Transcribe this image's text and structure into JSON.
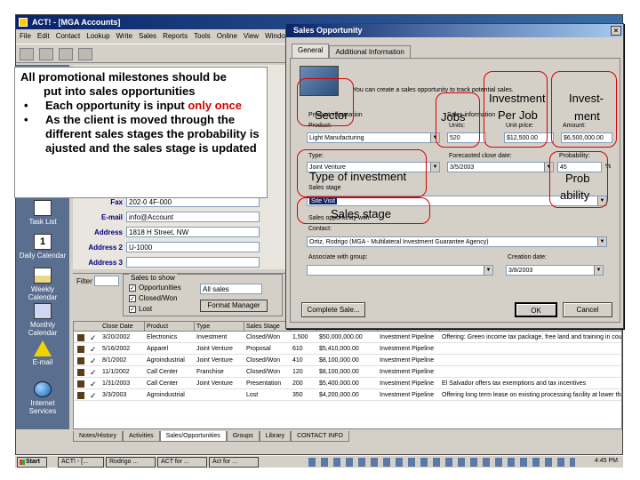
{
  "app": {
    "title": "ACT! - [MGA Accounts]",
    "menu": [
      "File",
      "Edit",
      "Contact",
      "Lookup",
      "Write",
      "Sales",
      "Reports",
      "Tools",
      "Online",
      "View",
      "Window"
    ]
  },
  "nav": {
    "items": [
      {
        "label": "Task List"
      },
      {
        "label": "Daily Calendar",
        "icon_text": "1"
      },
      {
        "label": "Weekly Calendar"
      },
      {
        "label": "Monthly Calendar"
      },
      {
        "label": "E-mail"
      },
      {
        "label": "Internet Services"
      }
    ]
  },
  "contact": {
    "fields": [
      {
        "label": "Fax",
        "value": "202-0 4F-000"
      },
      {
        "label": "E-mail",
        "value": "info@Account"
      },
      {
        "label": "Address",
        "value": "1818 H Street, NW"
      },
      {
        "label": "Address 2",
        "value": "U-1000"
      },
      {
        "label": "Address 3",
        "value": ""
      }
    ]
  },
  "filter": {
    "label": "Filter",
    "show_title": "Sales to show",
    "options": [
      {
        "label": "Opportunities",
        "checked": "✓"
      },
      {
        "label": "Closed/Won",
        "checked": "✓"
      },
      {
        "label": "Lost",
        "checked": "✓"
      }
    ],
    "select_value": "All sales",
    "format_manager": "Format Manager"
  },
  "grid": {
    "headers": [
      "Close Date",
      "Product",
      "Type",
      "Sales Stage",
      "Units",
      "Amount",
      "Manager",
      "Details"
    ],
    "rows": [
      {
        "cells": [
          "3/20/2002",
          "Electronics",
          "Investment",
          "Closed/Won",
          "1,500",
          "$50,000,000.00",
          "Investment Pipeline",
          "Offering: Green income tax package, free land and training in country"
        ]
      },
      {
        "cells": [
          "5/16/2002",
          "Apparel",
          "Joint Venture",
          "Proposal",
          "610",
          "$5,410,000.00",
          "Investment Pipeline",
          ""
        ]
      },
      {
        "cells": [
          "8/1/2002",
          "Agroindustrial",
          "Joint Venture",
          "Closed/Won",
          "410",
          "$8,100,000.00",
          "Investment Pipeline",
          ""
        ]
      },
      {
        "cells": [
          "11/1/2002",
          "Call Center",
          "Franchise",
          "Closed/Won",
          "120",
          "$8,100,000.00",
          "Investment Pipeline",
          ""
        ]
      },
      {
        "cells": [
          "1/31/2003",
          "Call Center",
          "Joint Venture",
          "Presentation",
          "200",
          "$5,400,000.00",
          "Investment Pipeline",
          "El Salvador offers tax exemptions and tax incentives"
        ]
      },
      {
        "cells": [
          "3/3/2003",
          "Agroindustrial",
          "",
          "Lost",
          "350",
          "$4,200,000.00",
          "Investment Pipeline",
          "Offering long term lease on existing processing facility at lower than market rates"
        ]
      }
    ]
  },
  "bottom_tabs": [
    "Notes/History",
    "Activities",
    "Sales/Opportunities",
    "Groups",
    "Library",
    "CONTACT INFO"
  ],
  "taskbar": {
    "start": "Start",
    "items": [
      "ACT! - [...",
      "Rodrigo ...",
      "ACT for ...",
      "Act for ..."
    ],
    "clock": "4:45 PM"
  },
  "dialog": {
    "title": "Sales Opportunity",
    "close": "×",
    "tabs": [
      "General",
      "Additional Information"
    ],
    "intro": "You can create a sales opportunity to track potential sales.",
    "product_info_label": "Product information",
    "product_label": "Product:",
    "product_value": "Light Manufacturing",
    "sales_info_label": "Sales information",
    "units_label": "Units:",
    "units_value": "520",
    "unit_price_label": "Unit price:",
    "unit_price_value": "$12,500.00",
    "amount_label": "Amount:",
    "amount_value": "$6,500,000.00",
    "type_label": "Type:",
    "type_value": "Joint Venture",
    "forecast_label": "Forecasted close date:",
    "forecast_value": "3/5/2003",
    "probability_label": "Probability:",
    "probability_value": "45",
    "percent": "%",
    "sales_stage_label": "Sales stage",
    "sales_stage_value": "Site Visit",
    "contact_group_label": "Sales opportunity with",
    "contact_label": "Contact:",
    "contact_value": "Ortiz, Rodrigo (MGA - Multilateral Investment Guarantee Agency)",
    "associate_label": "Associate with group:",
    "associate_value": "",
    "creation_label": "Creation date:",
    "creation_value": "3/8/2003",
    "complete_sale": "Complete Sale...",
    "ok": "OK",
    "cancel": "Cancel"
  },
  "annotation": {
    "title_line1": "All promotional milestones should be",
    "title_line2": "put into sales opportunities",
    "bullet1_prefix": "Each opportunity is input ",
    "bullet1_emph": "only once",
    "bullet2": "As the client is moved through the different sales stages the probability is ajusted and the sales stage is updated",
    "labels": {
      "sector": "Sector",
      "jobs": "Jobs",
      "investment_per_job_1": "Investment",
      "investment_per_job_2": "Per Job",
      "investment_1": "Invest-",
      "investment_2": "ment",
      "type_of_investment": "Type of investment",
      "probability_1": "Prob",
      "probability_2": "ability",
      "sales_stage": "Sales stage"
    }
  }
}
